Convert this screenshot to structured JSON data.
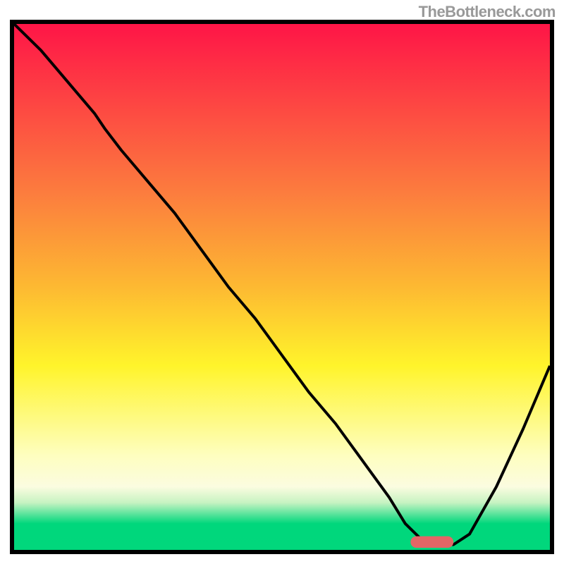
{
  "watermark": "TheBottleneck.com",
  "chart_data": {
    "type": "line",
    "title": "",
    "xlabel": "",
    "ylabel": "",
    "xlim": [
      0,
      100
    ],
    "ylim": [
      0,
      100
    ],
    "gradient_stops": [
      {
        "offset": 0,
        "color": "#fe1547"
      },
      {
        "offset": 32,
        "color": "#fc7c3e"
      },
      {
        "offset": 50,
        "color": "#fdb932"
      },
      {
        "offset": 65,
        "color": "#fff42b"
      },
      {
        "offset": 82,
        "color": "#fefebf"
      },
      {
        "offset": 88,
        "color": "#fbfce0"
      },
      {
        "offset": 91,
        "color": "#c7f3c2"
      },
      {
        "offset": 95,
        "color": "#00d77c"
      },
      {
        "offset": 100,
        "color": "#01d77c"
      }
    ],
    "series": [
      {
        "name": "bottleneck-curve",
        "x": [
          0,
          5,
          10,
          15,
          17,
          20,
          25,
          30,
          35,
          40,
          45,
          50,
          55,
          60,
          65,
          70,
          73,
          76,
          79,
          82,
          85,
          90,
          95,
          100
        ],
        "values": [
          100,
          95,
          89,
          83,
          80,
          76,
          70,
          64,
          57,
          50,
          44,
          37,
          30,
          24,
          17,
          10,
          5,
          2,
          1,
          1,
          3,
          12,
          23,
          35
        ]
      }
    ],
    "marker": {
      "name": "optimal-range",
      "x": 78,
      "y": 1.5,
      "width": 8,
      "height": 2.2,
      "color": "#e36666"
    }
  }
}
